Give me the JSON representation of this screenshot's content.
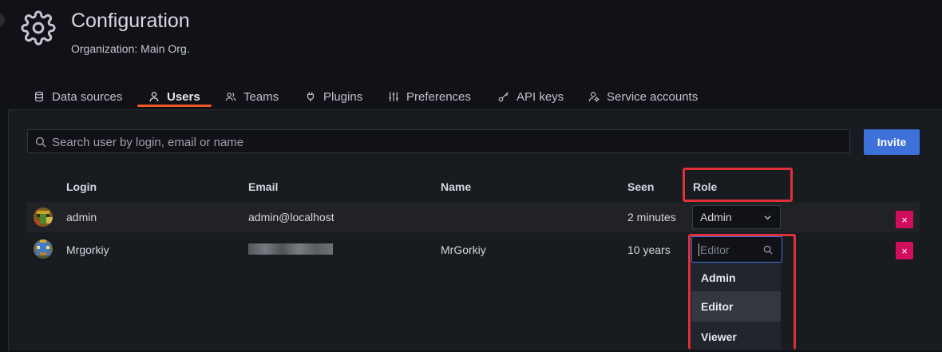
{
  "header": {
    "title": "Configuration",
    "subtitle": "Organization: Main Org.",
    "icon": "gear-icon"
  },
  "tabs": [
    {
      "label": "Data sources",
      "icon": "database-icon",
      "active": false
    },
    {
      "label": "Users",
      "icon": "user-icon",
      "active": true
    },
    {
      "label": "Teams",
      "icon": "users-icon",
      "active": false
    },
    {
      "label": "Plugins",
      "icon": "plug-icon",
      "active": false
    },
    {
      "label": "Preferences",
      "icon": "sliders-icon",
      "active": false
    },
    {
      "label": "API keys",
      "icon": "key-icon",
      "active": false
    },
    {
      "label": "Service accounts",
      "icon": "user-cog-icon",
      "active": false
    }
  ],
  "search": {
    "placeholder": "Search user by login, email or name",
    "value": ""
  },
  "invite_label": "Invite",
  "table": {
    "columns": [
      "Login",
      "Email",
      "Name",
      "Seen",
      "Role"
    ],
    "rows": [
      {
        "login": "admin",
        "email": "admin@localhost",
        "name": "",
        "seen": "2 minutes",
        "role": "Admin"
      },
      {
        "login": "Mrgorkiy",
        "email": "",
        "name": "MrGorkiy",
        "seen": "10 years",
        "role": "Editor"
      }
    ]
  },
  "role_dropdown": {
    "placeholder": "Editor",
    "options": [
      "Admin",
      "Editor",
      "Viewer"
    ],
    "highlighted": "Editor"
  },
  "delete_label": "×",
  "colors": {
    "accent": "#3d71d9",
    "tab_underline": "#f05a28",
    "delete": "#d10e5c",
    "highlight_box": "#e0303c"
  }
}
